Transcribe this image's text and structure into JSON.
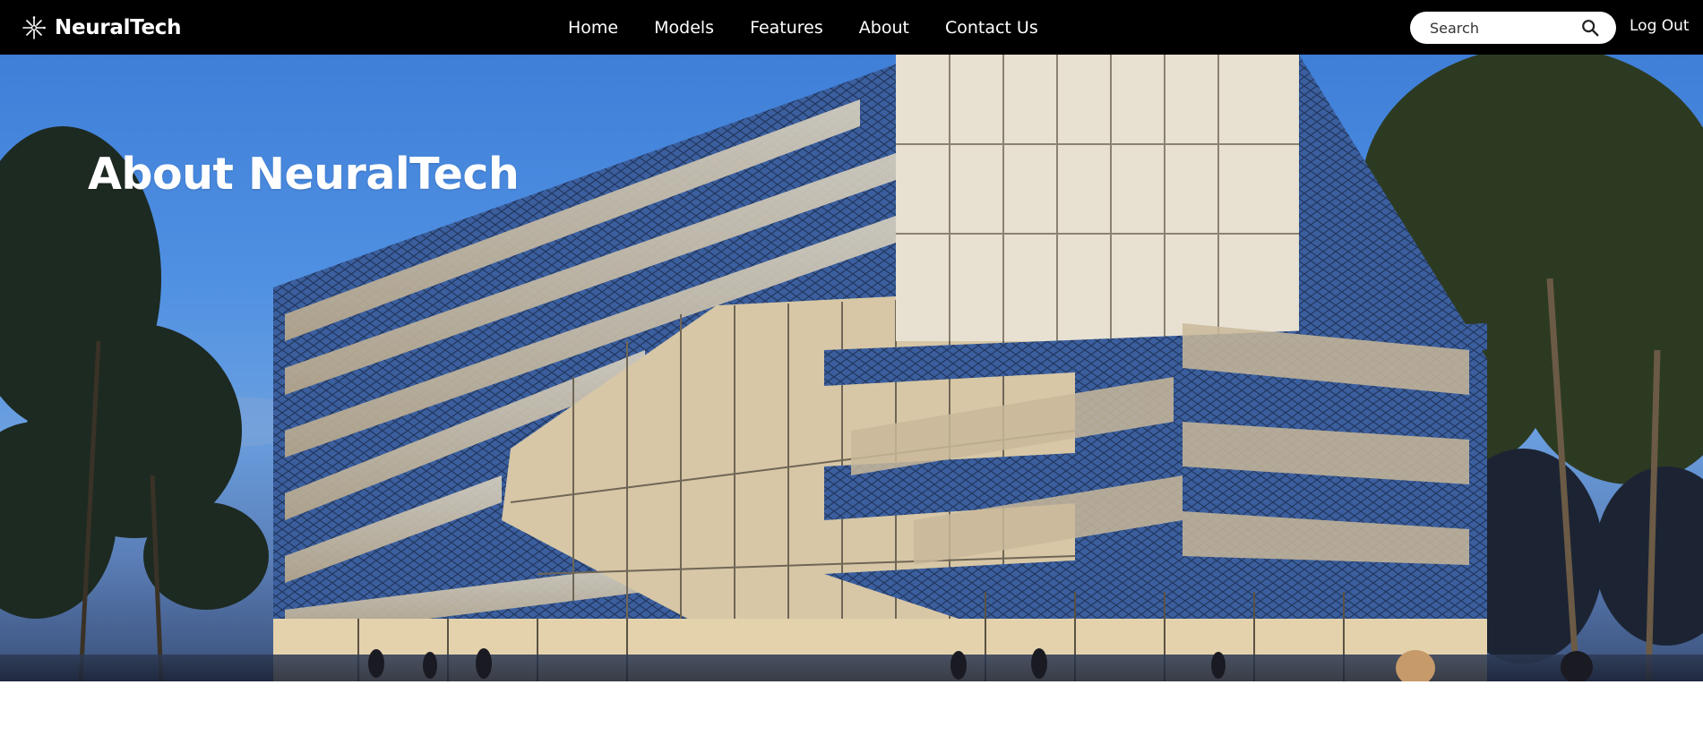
{
  "brand": {
    "name": "NeuralTech",
    "logo_icon": "neural-spark-icon"
  },
  "nav": {
    "items": [
      {
        "label": "Home"
      },
      {
        "label": "Models"
      },
      {
        "label": "Features"
      },
      {
        "label": "About"
      },
      {
        "label": "Contact Us"
      }
    ]
  },
  "search": {
    "placeholder": "Search",
    "value": "",
    "icon": "search-icon"
  },
  "logout_label": "Log Out",
  "hero": {
    "title": "About NeuralTech",
    "image_description_icon": "office-building-photo"
  },
  "colors": {
    "navbar_bg": "#000000",
    "nav_text": "#ffffff",
    "hero_title": "#ffffff",
    "page_bg": "#ffffff"
  }
}
